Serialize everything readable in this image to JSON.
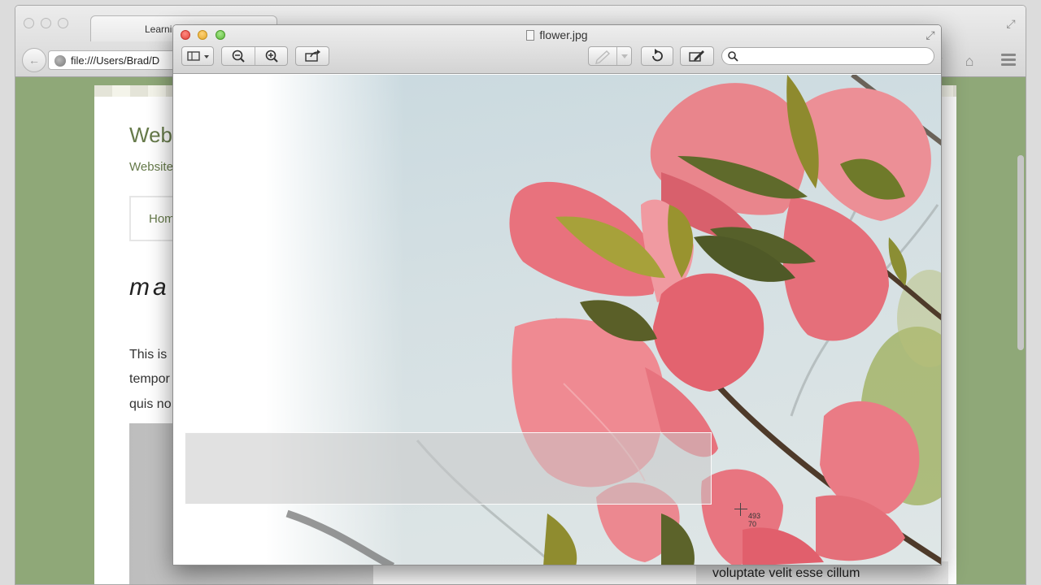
{
  "browser": {
    "tab_title": "Learni",
    "address": "file:///Users/Brad/D",
    "page": {
      "site_title": "Webs",
      "tagline": "Website",
      "nav_home": "Hom",
      "post_title": "ma",
      "body_lines": [
        "This is",
        "tempor",
        "quis no"
      ],
      "bottom_text": "voluptate velit esse cillum"
    }
  },
  "preview": {
    "file_name": "flower.jpg",
    "toolbar": {
      "sidebar_icon": "sidebar-icon",
      "zoom_out_icon": "zoom-out-icon",
      "zoom_in_icon": "zoom-in-icon",
      "share_icon": "share-icon",
      "annotate_icon": "pen-icon",
      "rotate_icon": "rotate-icon",
      "edit_icon": "edit-toolbar-icon"
    },
    "search": {
      "placeholder": "",
      "value": ""
    },
    "selection_readout": {
      "x": "493",
      "y": "70"
    }
  },
  "colors": {
    "desktop_green": "#8fa878",
    "site_text_green": "#667a4a",
    "petal_pink": "#e8707a",
    "sky": "#cfdde2"
  }
}
